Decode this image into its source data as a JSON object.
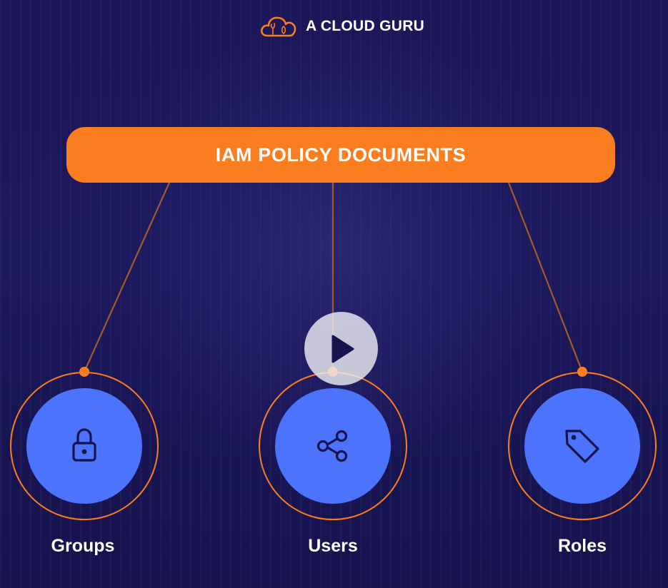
{
  "brand": {
    "name": "A CLOUD GURU",
    "logo_icon": "cloud-logo-icon",
    "logo_color": "#fa7d1f"
  },
  "banner": {
    "title": "IAM POLICY DOCUMENTS",
    "color": "#fa7d1f"
  },
  "nodes": [
    {
      "label": "Groups",
      "icon": "lock-icon"
    },
    {
      "label": "Users",
      "icon": "share-icon"
    },
    {
      "label": "Roles",
      "icon": "tag-icon"
    }
  ],
  "colors": {
    "background": "#17134f",
    "node_fill": "#4c73fb",
    "icon_stroke": "#17134f",
    "connector": "#a65a2c",
    "text": "#ffffff"
  },
  "player": {
    "control_icon": "play-icon"
  }
}
